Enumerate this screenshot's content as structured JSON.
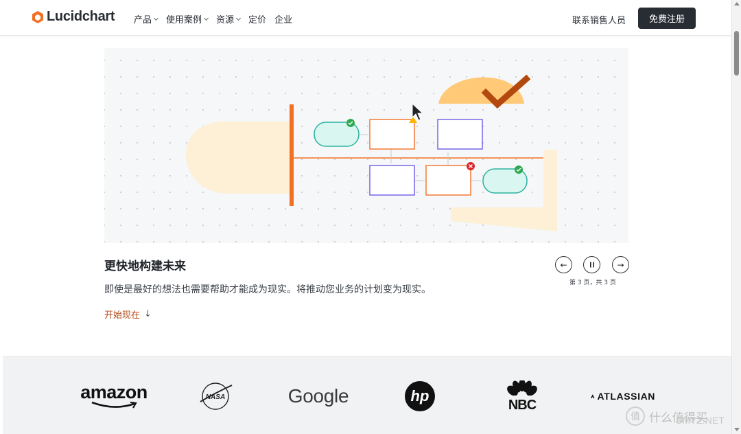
{
  "nav": {
    "logo_text": "Lucidchart",
    "menu": [
      {
        "label": "产品",
        "has_dropdown": true
      },
      {
        "label": "使用案例",
        "has_dropdown": true
      },
      {
        "label": "资源",
        "has_dropdown": true
      },
      {
        "label": "定价",
        "has_dropdown": false
      },
      {
        "label": "企业",
        "has_dropdown": false
      }
    ],
    "sales_link": "联系销售人员",
    "signup_button": "免费注册"
  },
  "colors": {
    "brand_orange": "#f27024",
    "dark_button": "#282c33",
    "cta_text": "#b04a14",
    "teal_node": "#d9f7f0",
    "purple_outline": "#6b5ce7",
    "success_green": "#2fa84f",
    "error_red": "#d9262b"
  },
  "slide": {
    "title": "更快地构建未来",
    "description": "即使是最好的想法也需要帮助才能成为现实。将推动您业务的计划变为现实。",
    "cta": "开始现在",
    "cta_icon": "arrow-down-icon"
  },
  "carousel": {
    "prev_icon": "arrow-left-icon",
    "pause_icon": "pause-icon",
    "next_icon": "arrow-right-icon",
    "page_indicator": "第 3 页，共 3 页"
  },
  "logos": {
    "amazon": "amazon",
    "nasa": "NASA",
    "google": "Google",
    "hp": "hp",
    "nbc": "NBC",
    "atlassian": "ATLASSIAN"
  },
  "watermark": {
    "symbol": "值",
    "text": "什么值得买",
    "site": "SMYZ.NET"
  }
}
